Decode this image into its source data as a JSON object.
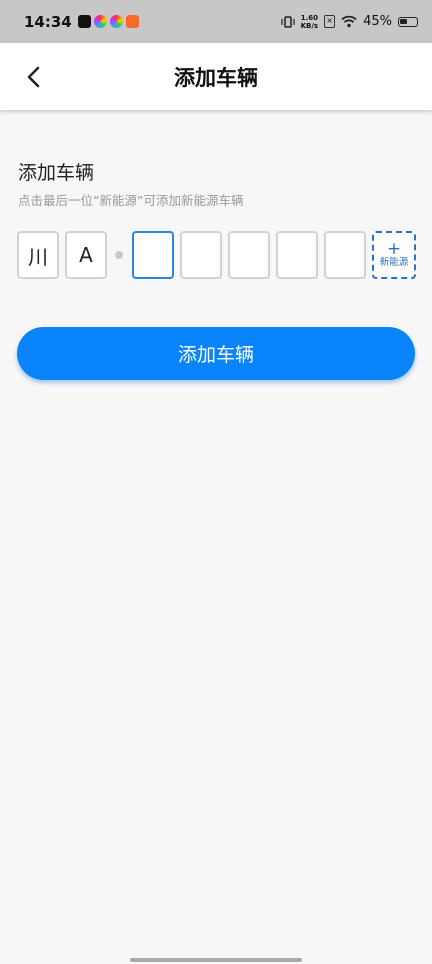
{
  "status_bar": {
    "time": "14:34",
    "net_speed_value": "1.60",
    "net_speed_unit": "KB/s",
    "battery_percent": "45%",
    "battery_level": 0.45
  },
  "nav": {
    "title": "添加车辆",
    "back_icon": "chevron-left-icon"
  },
  "form": {
    "title": "添加车辆",
    "hint": "点击最后一位“新能源”可添加新能源车辆",
    "plate_chars": [
      "川",
      "A",
      "",
      "",
      "",
      "",
      ""
    ],
    "active_index": 2,
    "new_energy_plus": "+",
    "new_energy_label": "新能源"
  },
  "actions": {
    "submit_label": "添加车辆"
  },
  "colors": {
    "accent": "#0a84fa",
    "active_border": "#2a86db",
    "new_energy_border": "#2a72c8"
  }
}
